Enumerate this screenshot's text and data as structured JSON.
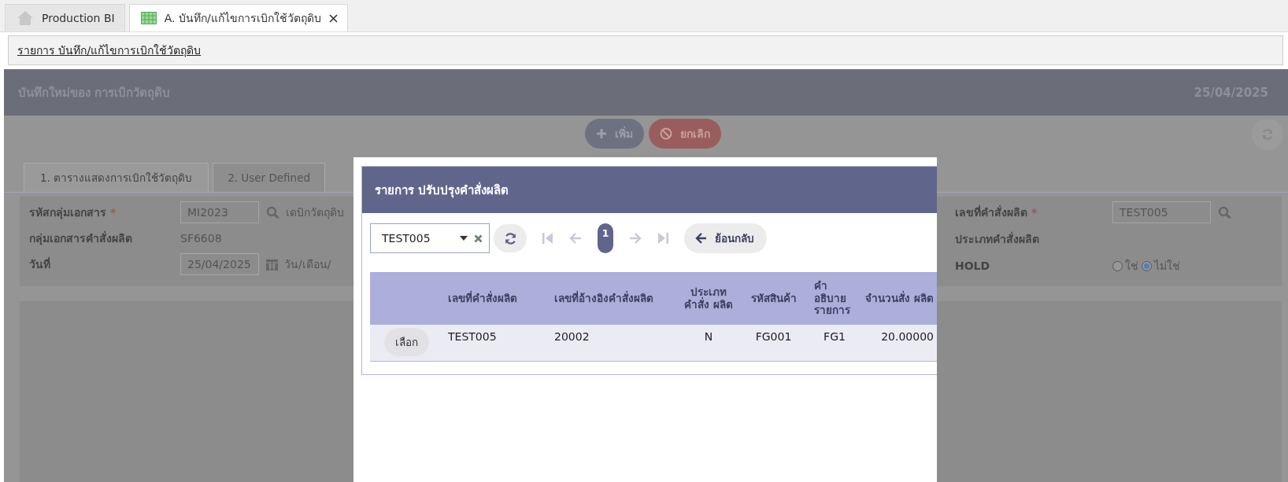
{
  "tabs": [
    {
      "label": "Production BI",
      "closable": false,
      "selected": false
    },
    {
      "label": "A. บันทึก/แก้ไขการเบิกใช้วัตถุดิบ",
      "closable": true,
      "selected": true
    }
  ],
  "breadcrumb": "รายการ บันทึก/แก้ไขการเบิกใช้วัตถุดิบ",
  "header": {
    "title": "บันทึกใหม่ของ การเบิกวัตถุดิบ",
    "date": "25/04/2025"
  },
  "actions": [
    {
      "kind": "add",
      "label": "เพิ่ม"
    },
    {
      "kind": "cancel",
      "label": "ยกเลิก"
    }
  ],
  "form_tabs": [
    {
      "label": "1. ตารางแสดงการเบิกใช้วัตถุดิบ",
      "selected": true
    },
    {
      "label": "2. User Defined",
      "selected": false
    }
  ],
  "form_left": [
    {
      "kind": "lookup",
      "label": "รหัสกลุ่มเอกสาร",
      "required_mark": "*",
      "value": "MI2023",
      "note": "เดบิกวัตถุดิบ"
    },
    {
      "kind": "text",
      "label": "กลุ่มเอกสารคำสั่งผลิต",
      "value": "SF6608"
    },
    {
      "kind": "date",
      "label": "วันที่",
      "value": "25/04/2025",
      "note": "วัน/เดือน/"
    }
  ],
  "form_right": [
    {
      "kind": "lookup",
      "label": "เลขที่คำสั่งผลิต",
      "required_mark": "*",
      "value": "TEST005"
    },
    {
      "kind": "label",
      "label": "ประเภทคำสั่งผลิต"
    },
    {
      "kind": "radio",
      "label": "HOLD",
      "options": [
        {
          "label": "ใช่",
          "selected": false
        },
        {
          "label": "ไม่ใช่",
          "selected": true
        }
      ]
    }
  ],
  "modal": {
    "title": "รายการ ปรับปรุงคำสั่งผลิต",
    "search": {
      "value": "TEST005"
    },
    "page": "1",
    "back": "ย้อนกลับ",
    "columns": [
      "เลขที่คำสั่งผลิต",
      "เลขที่อ้างอิงคำสั่งผลิต",
      "ประเภท คำสั่ง ผลิต",
      "รหัสสินค้า",
      "คำ อธิบาย รายการ",
      "จำนวนสั่ง ผลิต"
    ],
    "rows": [
      {
        "action": "เลือก",
        "cells": [
          "TEST005",
          "20002",
          "N",
          "FG001",
          "FG1",
          "20.00000"
        ]
      }
    ]
  }
}
